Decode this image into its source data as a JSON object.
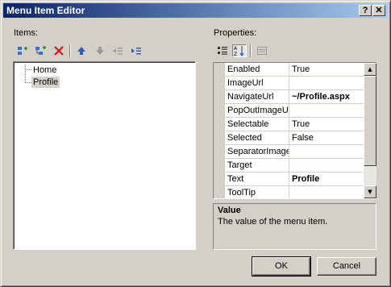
{
  "window": {
    "title": "Menu Item Editor",
    "help_glyph": "?",
    "close_glyph": "✕"
  },
  "items_panel": {
    "label": "Items:",
    "toolbar_icons": [
      "add-root-item-icon",
      "add-child-item-icon",
      "delete-item-icon",
      "move-up-icon",
      "move-down-icon",
      "outdent-icon",
      "indent-icon"
    ],
    "tree": [
      {
        "label": "Home"
      },
      {
        "label": "Profile",
        "selected": true
      }
    ]
  },
  "properties_panel": {
    "label": "Properties:",
    "toolbar_icons": [
      "categorized-icon",
      "alphabetical-icon",
      "property-pages-icon"
    ],
    "rows": [
      {
        "name": "Enabled",
        "value": "True",
        "bold": false
      },
      {
        "name": "ImageUrl",
        "value": "",
        "bold": false
      },
      {
        "name": "NavigateUrl",
        "value": "~/Profile.aspx",
        "bold": true
      },
      {
        "name": "PopOutImageUrl",
        "value": "",
        "bold": false
      },
      {
        "name": "Selectable",
        "value": "True",
        "bold": false
      },
      {
        "name": "Selected",
        "value": "False",
        "bold": false
      },
      {
        "name": "SeparatorImageUrl",
        "value": "",
        "bold": false
      },
      {
        "name": "Target",
        "value": "",
        "bold": false
      },
      {
        "name": "Text",
        "value": "Profile",
        "bold": true
      },
      {
        "name": "ToolTip",
        "value": "",
        "bold": false
      }
    ],
    "description": {
      "title": "Value",
      "text": "The value of the menu item."
    }
  },
  "buttons": {
    "ok": "OK",
    "cancel": "Cancel"
  },
  "colors": {
    "title_start": "#0a246a",
    "title_end": "#a6caf0",
    "face": "#d4d0c8"
  }
}
